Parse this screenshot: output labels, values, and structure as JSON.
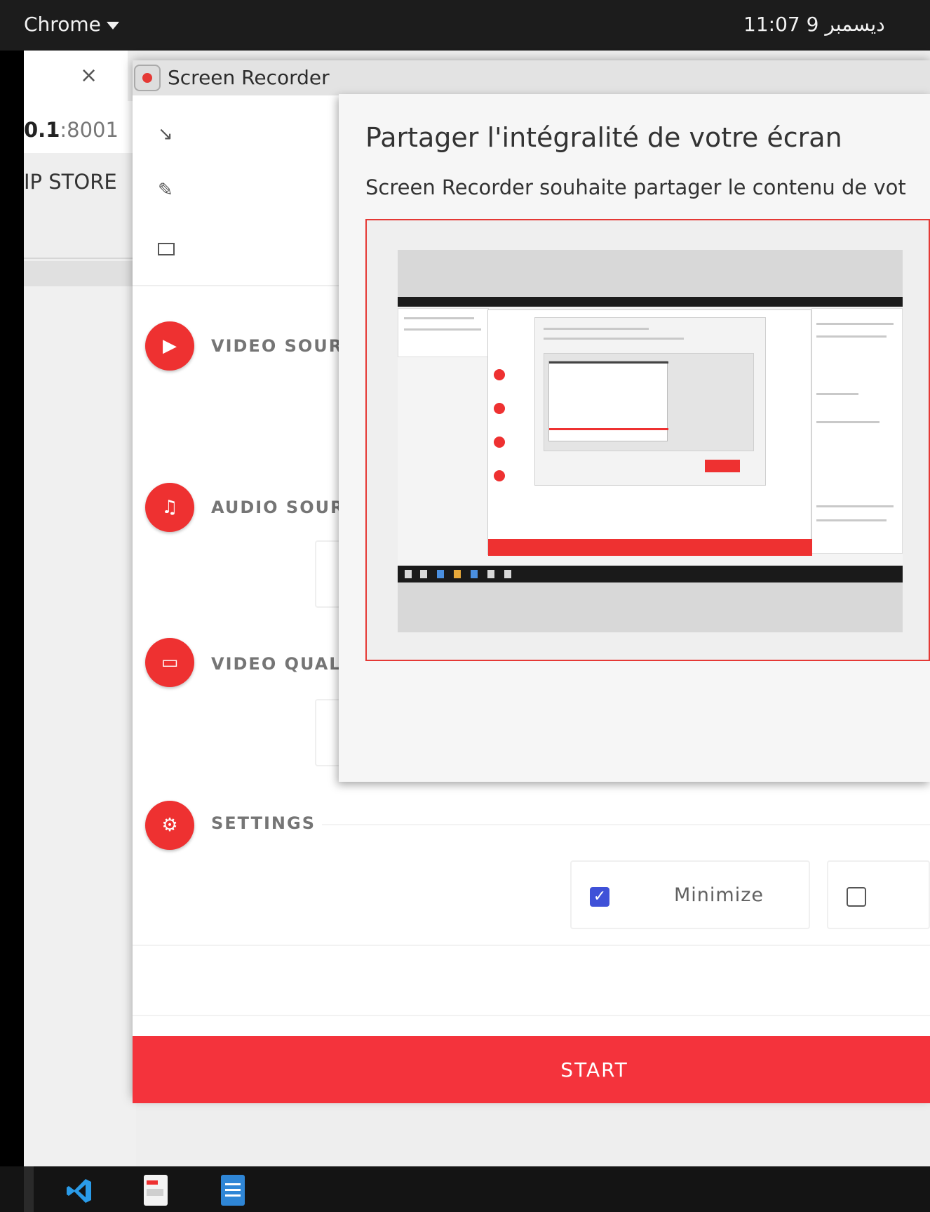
{
  "system_bar": {
    "app_menu": "Chrome",
    "clock": "ديسمبر 9  11:07"
  },
  "browser": {
    "tab_close": "×",
    "url_host": "0.1",
    "url_port": ":8001",
    "bookmark": "IP STORE"
  },
  "screen_recorder": {
    "window_title": "Screen Recorder",
    "tools": [
      "crop-icon",
      "pen-icon",
      "screen-icon"
    ],
    "sections": {
      "video_source": "VIDEO SOUR",
      "audio_source": "AUDIO SOUR",
      "video_quality": "VIDEO QUALI",
      "settings": "SETTINGS"
    },
    "settings_options": [
      {
        "label": "Minimize",
        "checked": true
      },
      {
        "label": "",
        "checked": false
      }
    ],
    "start_label": "START",
    "accent_color": "#f4333c",
    "checkbox_color": "#3f51d8"
  },
  "share_dialog": {
    "title": "Partager l'intégralité de votre écran",
    "description": "Screen Recorder souhaite partager le contenu de vot",
    "preview_selected": true,
    "selection_color": "#e53935"
  },
  "dock": {
    "icons": [
      "vscode-icon",
      "document-viewer-icon",
      "text-editor-icon"
    ]
  }
}
